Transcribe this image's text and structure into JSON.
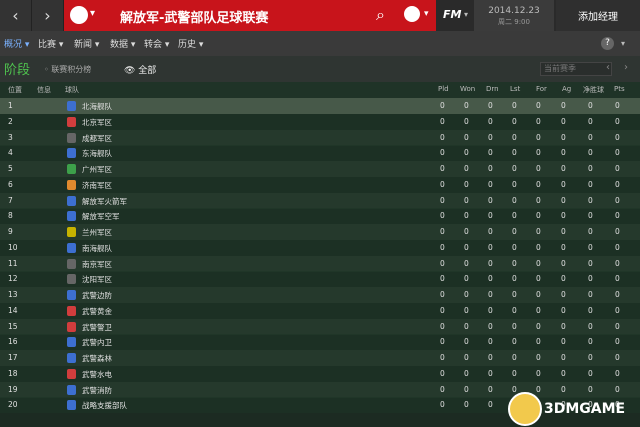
{
  "nav": {
    "back_icon": "‹",
    "forward_icon": "›"
  },
  "header": {
    "title": "解放军-武警部队足球联赛",
    "fm_logo": "FM",
    "date": "2014.12.23",
    "day": "周二 9:00",
    "add_manager": "添加经理"
  },
  "menu": [
    {
      "label": "概况 ▾",
      "active": true
    },
    {
      "label": "比赛 ▾"
    },
    {
      "label": "新闻 ▾"
    },
    {
      "label": "数据 ▾"
    },
    {
      "label": "转会 ▾"
    },
    {
      "label": "历史 ▾"
    }
  ],
  "filters": {
    "stage": "阶段",
    "league_table": "◦ 联赛积分榜",
    "all": "👁 全部",
    "season": "当前赛季"
  },
  "table": {
    "headers": [
      "位置",
      "信息",
      "球队",
      "Pld",
      "Won",
      "Drn",
      "Lst",
      "For",
      "Ag",
      "净胜球",
      "Pts"
    ],
    "rows": [
      {
        "pos": "1",
        "team": "北海舰队",
        "color": "#3d6fd1"
      },
      {
        "pos": "2",
        "team": "北京军区",
        "color": "#d13d3d"
      },
      {
        "pos": "3",
        "team": "成都军区",
        "color": "#666666"
      },
      {
        "pos": "4",
        "team": "东海舰队",
        "color": "#3d6fd1"
      },
      {
        "pos": "5",
        "team": "广州军区",
        "color": "#3da04a"
      },
      {
        "pos": "6",
        "team": "济南军区",
        "color": "#e08a2e"
      },
      {
        "pos": "7",
        "team": "解放军火箭军",
        "color": "#3d6fd1"
      },
      {
        "pos": "8",
        "team": "解放军空军",
        "color": "#3d6fd1"
      },
      {
        "pos": "9",
        "team": "兰州军区",
        "color": "#c7b300"
      },
      {
        "pos": "10",
        "team": "南海舰队",
        "color": "#3d6fd1"
      },
      {
        "pos": "11",
        "team": "南京军区",
        "color": "#666666"
      },
      {
        "pos": "12",
        "team": "沈阳军区",
        "color": "#666666"
      },
      {
        "pos": "13",
        "team": "武警边防",
        "color": "#3d6fd1"
      },
      {
        "pos": "14",
        "team": "武警黄金",
        "color": "#d13d3d"
      },
      {
        "pos": "15",
        "team": "武警警卫",
        "color": "#d13d3d"
      },
      {
        "pos": "16",
        "team": "武警内卫",
        "color": "#3d6fd1"
      },
      {
        "pos": "17",
        "team": "武警森林",
        "color": "#3d6fd1"
      },
      {
        "pos": "18",
        "team": "武警水电",
        "color": "#d13d3d"
      },
      {
        "pos": "19",
        "team": "武警消防",
        "color": "#3d6fd1"
      },
      {
        "pos": "20",
        "team": "战略支援部队",
        "color": "#3d6fd1"
      }
    ],
    "zero": "0"
  },
  "watermark": "3DMGAME"
}
